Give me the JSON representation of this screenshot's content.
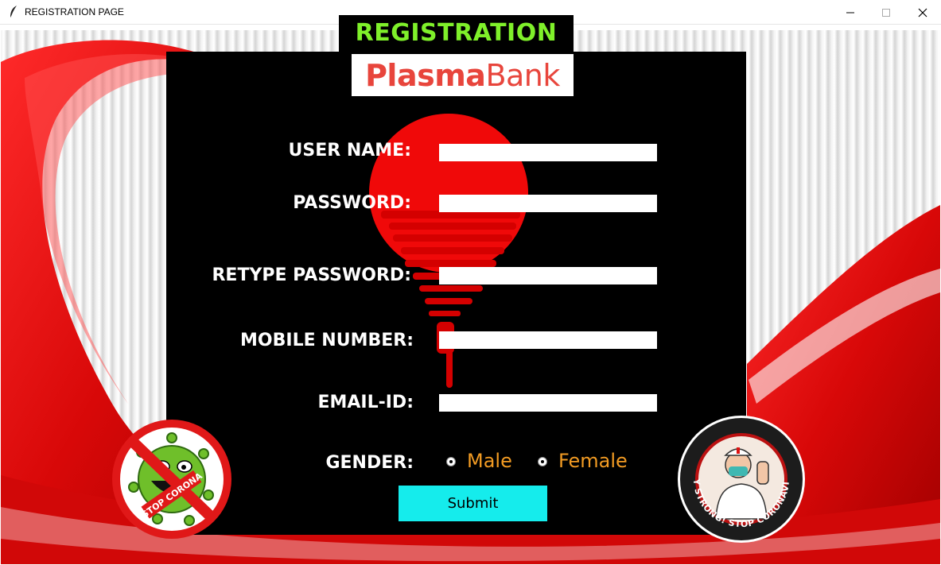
{
  "window": {
    "title": "REGISTRATION PAGE",
    "icons": [
      "feather-icon",
      "minimize-icon",
      "maximize-icon",
      "close-icon"
    ]
  },
  "header": {
    "title": "REGISTRATION"
  },
  "logo": {
    "part1": "Plasma",
    "part2": "Bank"
  },
  "form": {
    "username_label": "USER NAME:",
    "password_label": "PASSWORD:",
    "retype_label": "RETYPE PASSWORD:",
    "mobile_label": "MOBILE NUMBER:",
    "email_label": "EMAIL-ID:",
    "gender_label": "GENDER:",
    "username_value": "",
    "password_value": "",
    "retype_value": "",
    "mobile_value": "",
    "email_value": "",
    "gender_options": [
      "Male",
      "Female"
    ],
    "submit_label": "Submit"
  },
  "badges": {
    "left_text": "STOP CORONA",
    "right_text": "STAY STRONG! STOP CORONAVIRUS"
  },
  "colors": {
    "panel": "#000000",
    "header_text": "#7ff02a",
    "logo_text": "#e8453c",
    "gender_text": "#f29b23",
    "submit_bg": "#15ecec",
    "ribbon": "#e01010"
  }
}
